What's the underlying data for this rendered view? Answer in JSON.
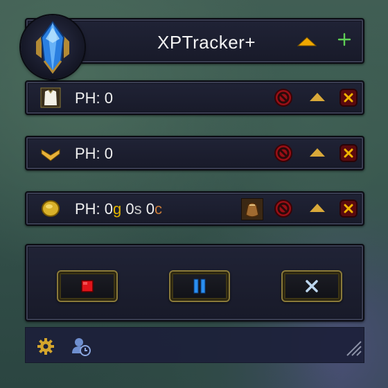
{
  "app": {
    "title": "XPTracker+"
  },
  "header": {
    "icons": [
      "crystal-logo",
      "collapse-up-icon",
      "add-icon"
    ]
  },
  "rows": [
    {
      "icon": "tabard-icon",
      "label": "PH: 0"
    },
    {
      "icon": "chevron-rank-icon",
      "label": "PH: 0"
    },
    {
      "icon": "gold-coin-icon",
      "label_prefix": "PH: ",
      "gold": "0",
      "gold_unit": "g",
      "silver": "0",
      "silver_unit": "s",
      "copper": "0",
      "copper_unit": "c"
    }
  ],
  "controls": {
    "stop": "stop-icon",
    "pause": "pause-icon",
    "close": "close-x-icon"
  },
  "footer": {
    "icons": [
      "settings-gear-icon",
      "user-clock-icon",
      "resize-grip-icon"
    ]
  },
  "colors": {
    "gold": "#e2b500",
    "accent_orange": "#f0a800",
    "green_plus": "#58c24f",
    "red_btn": "#8a1010"
  }
}
